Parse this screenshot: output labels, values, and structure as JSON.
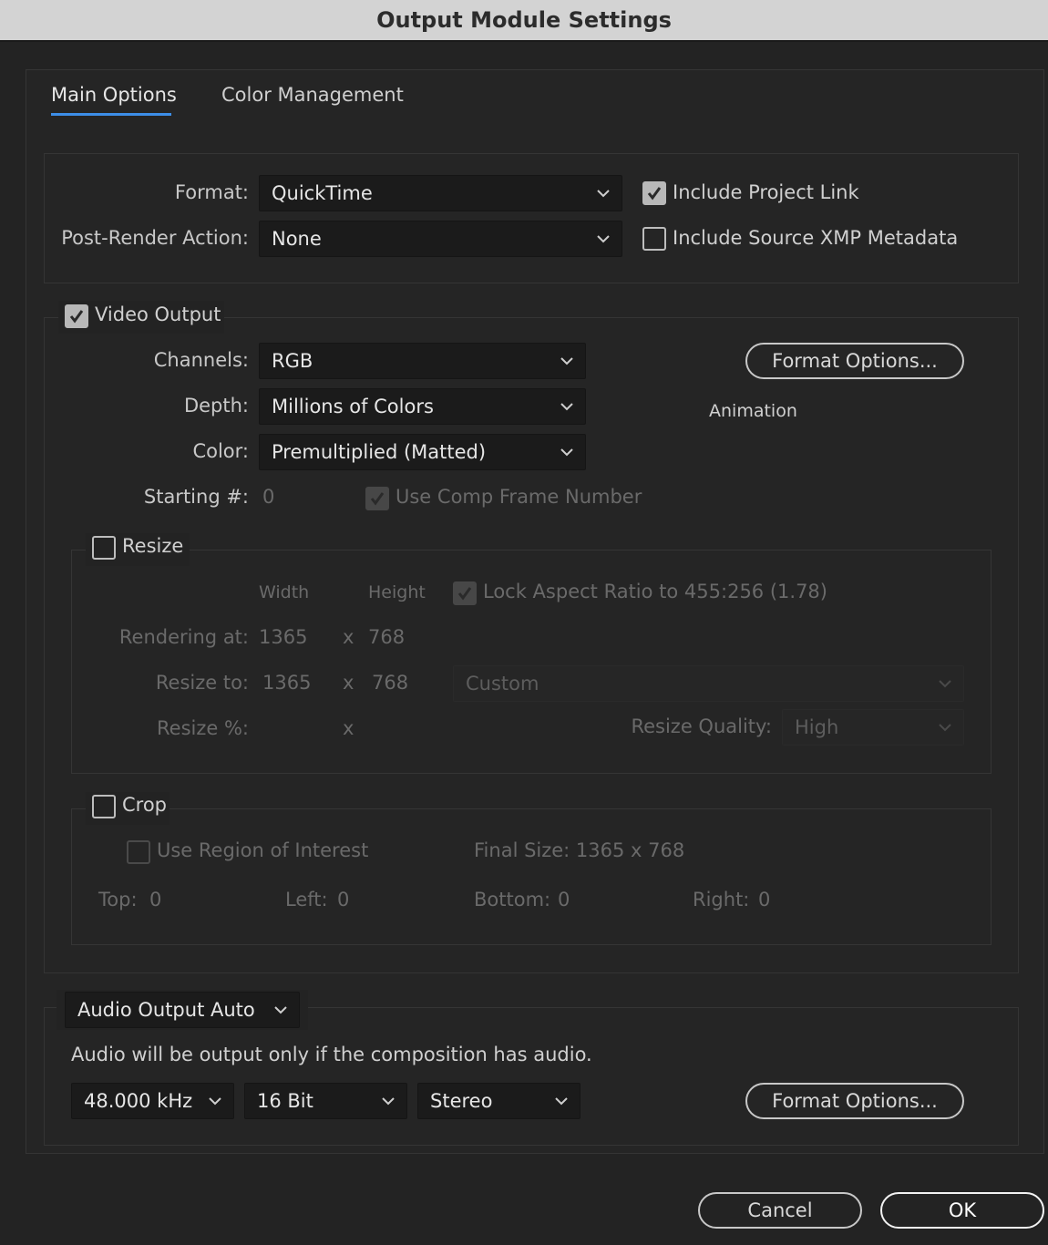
{
  "window": {
    "title": "Output Module Settings"
  },
  "tabs": [
    {
      "label": "Main Options",
      "active": true
    },
    {
      "label": "Color Management",
      "active": false
    }
  ],
  "general": {
    "format_label": "Format:",
    "format_value": "QuickTime",
    "post_render_label": "Post-Render Action:",
    "post_render_value": "None",
    "include_project_link": {
      "label": "Include Project Link",
      "checked": true
    },
    "include_xmp": {
      "label": "Include Source XMP Metadata",
      "checked": false
    }
  },
  "video": {
    "section_label": "Video Output",
    "checked": true,
    "channels_label": "Channels:",
    "channels_value": "RGB",
    "depth_label": "Depth:",
    "depth_value": "Millions of Colors",
    "color_label": "Color:",
    "color_value": "Premultiplied (Matted)",
    "starting_label": "Starting #:",
    "starting_value": "0",
    "use_comp_frame": {
      "label": "Use Comp Frame Number",
      "checked": true,
      "disabled": true
    },
    "format_options_label": "Format Options...",
    "codec_text": "Animation"
  },
  "resize": {
    "section_label": "Resize",
    "checked": false,
    "width_header": "Width",
    "height_header": "Height",
    "lock_aspect": {
      "label": "Lock Aspect Ratio to 455:256 (1.78)",
      "checked": true,
      "disabled": true
    },
    "rendering_at_label": "Rendering at:",
    "rendering_w": "1365",
    "rendering_h": "768",
    "resize_to_label": "Resize to:",
    "resize_w": "1365",
    "resize_h": "768",
    "preset_value": "Custom",
    "resize_pct_label": "Resize %:",
    "x_sep": "x",
    "quality_label": "Resize Quality:",
    "quality_value": "High"
  },
  "crop": {
    "section_label": "Crop",
    "checked": false,
    "use_roi": {
      "label": "Use Region of Interest",
      "checked": false,
      "disabled": true
    },
    "final_size": "Final Size: 1365 x 768",
    "top_label": "Top:",
    "top_value": "0",
    "left_label": "Left:",
    "left_value": "0",
    "bottom_label": "Bottom:",
    "bottom_value": "0",
    "right_label": "Right:",
    "right_value": "0"
  },
  "audio": {
    "mode_value": "Audio Output Auto",
    "note": "Audio will be output only if the composition has audio.",
    "rate_value": "48.000 kHz",
    "bits_value": "16 Bit",
    "channels_value": "Stereo",
    "format_options_label": "Format Options..."
  },
  "footer": {
    "cancel_label": "Cancel",
    "ok_label": "OK"
  },
  "colors": {
    "accent": "#3d8ee8",
    "background": "#232323",
    "field": "#1b1b1b"
  },
  "icons": {
    "checkmark": "checkmark-icon",
    "dropdown": "chevron-down-icon"
  }
}
